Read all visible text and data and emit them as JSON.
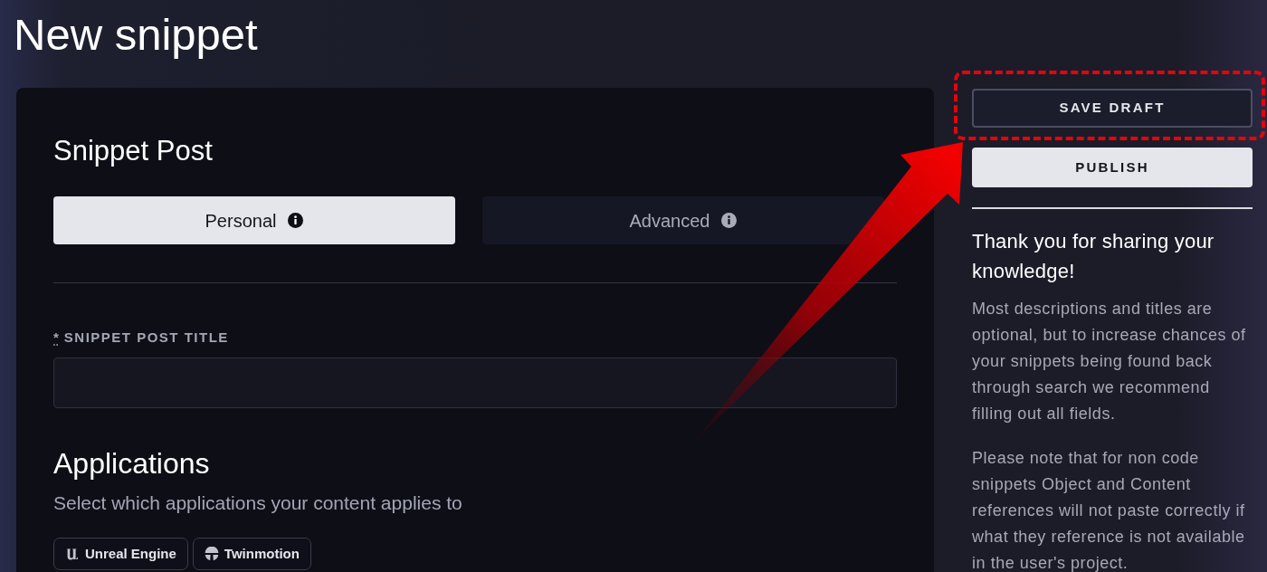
{
  "page": {
    "title": "New snippet"
  },
  "form": {
    "heading": "Snippet Post",
    "tabs": [
      {
        "label": "Personal",
        "selected": true
      },
      {
        "label": "Advanced",
        "selected": false
      }
    ],
    "title_field": {
      "required_mark": "*",
      "label": "SNIPPET POST TITLE"
    },
    "applications": {
      "heading": "Applications",
      "description": "Select which applications your content applies to",
      "chips": [
        {
          "label": "Unreal Engine",
          "kind": "unreal",
          "selected": false
        },
        {
          "label": "Twinmotion",
          "kind": "twinmotion",
          "selected": false
        }
      ]
    }
  },
  "sidebar": {
    "buttons": [
      {
        "label": "SAVE DRAFT",
        "kind": "secondary",
        "highlighted": true
      },
      {
        "label": "PUBLISH",
        "kind": "primary",
        "highlighted": false
      }
    ],
    "heading": "Thank you for sharing your knowledge!",
    "paragraphs": [
      "Most descriptions and titles are optional, but to increase chances of your snippets being found back through search we recommend filling out all fields.",
      "Please note that for non code snippets Object and Content references will not paste correctly if what they reference is not available in the user's project."
    ]
  }
}
